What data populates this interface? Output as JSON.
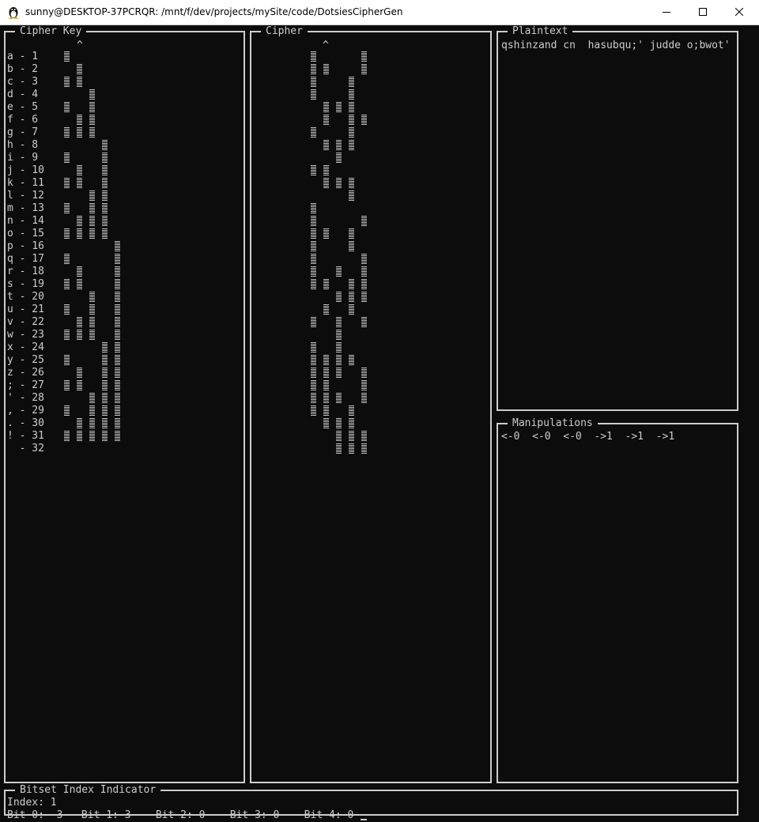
{
  "window": {
    "title": "sunny@DESKTOP-37PCRQR: /mnt/f/dev/projects/mySite/code/DotsiesCipherGen",
    "icon": "tux-penguin-icon",
    "controls": [
      "minimize-icon",
      "maximize-icon",
      "close-icon"
    ]
  },
  "cipher_key": {
    "title": "Cipher Key",
    "caret": "^",
    "entries": [
      {
        "label": "a - 1",
        "value": 1
      },
      {
        "label": "b - 2",
        "value": 2
      },
      {
        "label": "c - 3",
        "value": 3
      },
      {
        "label": "d - 4",
        "value": 4
      },
      {
        "label": "e - 5",
        "value": 5
      },
      {
        "label": "f - 6",
        "value": 6
      },
      {
        "label": "g - 7",
        "value": 7
      },
      {
        "label": "h - 8",
        "value": 8
      },
      {
        "label": "i - 9",
        "value": 9
      },
      {
        "label": "j - 10",
        "value": 10
      },
      {
        "label": "k - 11",
        "value": 11
      },
      {
        "label": "l - 12",
        "value": 12
      },
      {
        "label": "m - 13",
        "value": 13
      },
      {
        "label": "n - 14",
        "value": 14
      },
      {
        "label": "o - 15",
        "value": 15
      },
      {
        "label": "p - 16",
        "value": 16
      },
      {
        "label": "q - 17",
        "value": 17
      },
      {
        "label": "r - 18",
        "value": 18
      },
      {
        "label": "s - 19",
        "value": 19
      },
      {
        "label": "t - 20",
        "value": 20
      },
      {
        "label": "u - 21",
        "value": 21
      },
      {
        "label": "v - 22",
        "value": 22
      },
      {
        "label": "w - 23",
        "value": 23
      },
      {
        "label": "x - 24",
        "value": 24
      },
      {
        "label": "y - 25",
        "value": 25
      },
      {
        "label": "z - 26",
        "value": 26
      },
      {
        "label": "; - 27",
        "value": 27
      },
      {
        "label": "' - 28",
        "value": 28
      },
      {
        "label": ", - 29",
        "value": 29
      },
      {
        "label": ". - 30",
        "value": 30
      },
      {
        "label": "! - 31",
        "value": 31
      },
      {
        "label": "  - 32",
        "value": 32
      }
    ]
  },
  "cipher": {
    "title": "Cipher",
    "caret": "^",
    "rows": [
      [
        1,
        0,
        0,
        0,
        1
      ],
      [
        1,
        1,
        0,
        0,
        1
      ],
      [
        1,
        0,
        0,
        1,
        0
      ],
      [
        1,
        0,
        0,
        1,
        0
      ],
      [
        0,
        1,
        1,
        1,
        0
      ],
      [
        0,
        1,
        0,
        1,
        1
      ],
      [
        1,
        0,
        0,
        1,
        0
      ],
      [
        0,
        1,
        1,
        1,
        0
      ],
      [
        0,
        0,
        1,
        0,
        0
      ],
      [
        1,
        1,
        0,
        0,
        0
      ],
      [
        0,
        1,
        1,
        1,
        0
      ],
      [
        0,
        0,
        0,
        1,
        0
      ],
      [
        1,
        0,
        0,
        0,
        0
      ],
      [
        1,
        0,
        0,
        0,
        1
      ],
      [
        1,
        1,
        0,
        1,
        0
      ],
      [
        1,
        0,
        0,
        1,
        0
      ],
      [
        1,
        0,
        0,
        0,
        1
      ],
      [
        1,
        0,
        1,
        0,
        1
      ],
      [
        1,
        1,
        0,
        1,
        1
      ],
      [
        0,
        0,
        1,
        1,
        1
      ],
      [
        0,
        1,
        0,
        1,
        0
      ],
      [
        1,
        0,
        1,
        0,
        1
      ],
      [
        0,
        0,
        1,
        0,
        0
      ],
      [
        1,
        0,
        1,
        0,
        0
      ],
      [
        1,
        1,
        1,
        1,
        0
      ],
      [
        1,
        1,
        1,
        0,
        1
      ],
      [
        1,
        1,
        0,
        0,
        1
      ],
      [
        1,
        1,
        1,
        0,
        1
      ],
      [
        1,
        1,
        0,
        1,
        0
      ],
      [
        0,
        1,
        1,
        1,
        0
      ],
      [
        0,
        0,
        1,
        1,
        1
      ],
      [
        0,
        0,
        1,
        1,
        1
      ]
    ]
  },
  "plaintext": {
    "title": "Plaintext",
    "text": "qshinzand cn  hasubqu;' judde o;bwot'"
  },
  "manipulations": {
    "title": "Manipulations",
    "text": "<-0  <-0  <-0  ->1  ->1  ->1"
  },
  "bitset_indicator": {
    "title": "Bitset Index Indicator",
    "index_line": "Index: 1",
    "bit_line": "Bit 0: -3───Bit 1: 3────Bit 2: 0────Bit 3: 0────Bit 4: 0"
  }
}
